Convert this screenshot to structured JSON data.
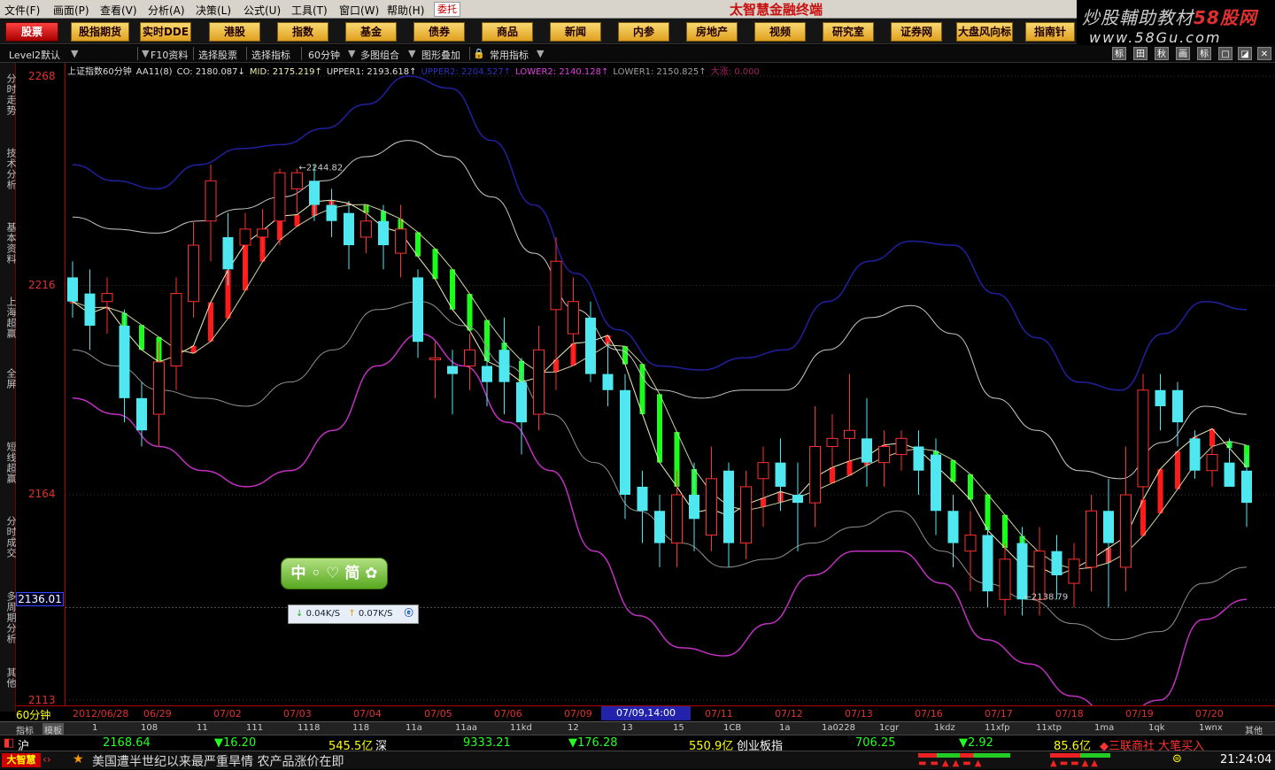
{
  "menu": [
    "文件(F)",
    "画面(P)",
    "查看(V)",
    "分析(A)",
    "决策(L)",
    "公式(U)",
    "工具(T)",
    "窗口(W)",
    "帮助(H)"
  ],
  "trust": "委托",
  "app_title": "太智慧金融终端",
  "brand": {
    "line1a": "炒股輔助教材",
    "line1b": "58股网",
    "line2": "www.58Gu.com"
  },
  "toolbar": [
    "股票",
    "股指期货",
    "实时DDE",
    "港股",
    "指数",
    "基金",
    "债券",
    "商品",
    "新闻",
    "内参",
    "房地产",
    "视频",
    "研究室",
    "证券网",
    "大盘风向标",
    "指南针"
  ],
  "subbar": [
    "Level2默认",
    "F10资料",
    "选择股票",
    "选择指标",
    "60分钟",
    "多图组合",
    "图形叠加",
    "常用指标"
  ],
  "right_icons": [
    "标",
    "田",
    "秋",
    "画",
    "标",
    "□",
    "◪",
    "✕"
  ],
  "side_nav": [
    "分时走势",
    "技术分析",
    "基本资料",
    "上海超赢",
    "全屏",
    "短线超赢",
    "分时成交",
    "多周期分析",
    "其他"
  ],
  "y_axis": {
    "labels": [
      "2268",
      "2216",
      "2164",
      "2113"
    ],
    "current": "2136.01"
  },
  "legend": [
    {
      "text": "上证指数60分钟",
      "color": "#e0e0e0"
    },
    {
      "text": "AA11(8)",
      "color": "#e0e0e0"
    },
    {
      "text": "CO: 2180.087↓",
      "color": "#e0e0e0"
    },
    {
      "text": "MID: 2175.219↑",
      "color": "#f0f0b0"
    },
    {
      "text": "UPPER1: 2193.618↑",
      "color": "#e0e0e0"
    },
    {
      "text": "UPPER2: 2204.527↑",
      "color": "#3030c0"
    },
    {
      "text": "LOWER2: 2140.128↑",
      "color": "#e040e0"
    },
    {
      "text": "LOWER1: 2150.825↑",
      "color": "#a0a0a0"
    },
    {
      "text": "大涨: 0.000",
      "color": "#a02060"
    }
  ],
  "annotations": {
    "high": "2244.82",
    "low": "2138.79"
  },
  "widgets": {
    "ime": "中 ◦ ♡ 简 ✿",
    "speed_down": "0.04K/S",
    "speed_up": "0.07K/S"
  },
  "x_axis": {
    "period": "60分钟",
    "labels": [
      "2012/06/28",
      "06/29",
      "07/02",
      "07/03",
      "07/04",
      "07/05",
      "07/06",
      "07/09",
      "07/11",
      "07/12",
      "07/13",
      "07/16",
      "07/17",
      "07/18",
      "07/19",
      "07/20"
    ],
    "current": "07/09,14:00"
  },
  "tabs": [
    "指标",
    "模板",
    "1",
    "108",
    "11",
    "111",
    "1118",
    "118",
    "11a",
    "11aa",
    "11kd",
    "12",
    "13",
    "15",
    "1CB",
    "1a",
    "1a0228",
    "1cgr",
    "1kdz",
    "11xfp",
    "11xtp",
    "1ma",
    "1qk",
    "1wnx",
    "其他"
  ],
  "quote": {
    "sh_label": "沪",
    "sh_index": "2168.64",
    "sh_change": "▼16.20",
    "sh_volume": "545.5亿",
    "sz_label": "深",
    "sz_index": "9333.21",
    "sz_change": "▼176.28",
    "sz_volume": "550.9亿",
    "cyb_label": "创业板指",
    "cyb_index": "706.25",
    "cyb_change": "▼2.92",
    "cyb_volume": "85.6亿",
    "broker_text": "◆三联商社 大笔买入"
  },
  "status": {
    "logo": "大智慧",
    "news": "美国遭半世纪以来最严重旱情 农产品涨价在即",
    "clock": "21:24:04"
  },
  "chart_data": {
    "type": "candlestick",
    "title": "上证指数60分钟",
    "ylim": [
      2113,
      2268
    ],
    "candles": [
      [
        2218,
        2212,
        2222,
        2208
      ],
      [
        2214,
        2206,
        2220,
        2200
      ],
      [
        2212,
        2214,
        2218,
        2204
      ],
      [
        2206,
        2188,
        2210,
        2182
      ],
      [
        2188,
        2180,
        2192,
        2176
      ],
      [
        2184,
        2197,
        2202,
        2176
      ],
      [
        2196,
        2214,
        2218,
        2190
      ],
      [
        2212,
        2226,
        2232,
        2208
      ],
      [
        2232,
        2242,
        2246,
        2222
      ],
      [
        2228,
        2220,
        2234,
        2216
      ],
      [
        2226,
        2230,
        2234,
        2218
      ],
      [
        2228,
        2230,
        2235,
        2224
      ],
      [
        2232,
        2244,
        2245,
        2226
      ],
      [
        2240,
        2244,
        2245,
        2234
      ],
      [
        2242,
        2236,
        2246,
        2232
      ],
      [
        2236,
        2232,
        2240,
        2228
      ],
      [
        2234,
        2226,
        2237,
        2220
      ],
      [
        2228,
        2232,
        2236,
        2224
      ],
      [
        2232,
        2226,
        2236,
        2220
      ],
      [
        2224,
        2230,
        2236,
        2218
      ],
      [
        2218,
        2202,
        2220,
        2198
      ],
      [
        2198,
        2198,
        2202,
        2188
      ],
      [
        2196,
        2194,
        2200,
        2184
      ],
      [
        2196,
        2200,
        2204,
        2190
      ],
      [
        2196,
        2192,
        2200,
        2186
      ],
      [
        2200,
        2192,
        2208,
        2184
      ],
      [
        2192,
        2182,
        2198,
        2174
      ],
      [
        2184,
        2200,
        2206,
        2180
      ],
      [
        2210,
        2222,
        2228,
        2190
      ],
      [
        2204,
        2212,
        2218,
        2196
      ],
      [
        2208,
        2194,
        2212,
        2192
      ],
      [
        2194,
        2190,
        2202,
        2186
      ],
      [
        2190,
        2164,
        2194,
        2158
      ],
      [
        2166,
        2160,
        2170,
        2152
      ],
      [
        2160,
        2152,
        2164,
        2146
      ],
      [
        2152,
        2164,
        2170,
        2146
      ],
      [
        2164,
        2158,
        2172,
        2150
      ],
      [
        2154,
        2168,
        2176,
        2150
      ],
      [
        2170,
        2152,
        2172,
        2146
      ],
      [
        2152,
        2166,
        2170,
        2148
      ],
      [
        2168,
        2172,
        2176,
        2156
      ],
      [
        2172,
        2166,
        2178,
        2160
      ],
      [
        2164,
        2162,
        2172,
        2150
      ],
      [
        2162,
        2176,
        2186,
        2156
      ],
      [
        2176,
        2178,
        2184,
        2170
      ],
      [
        2178,
        2180,
        2194,
        2172
      ],
      [
        2178,
        2172,
        2188,
        2166
      ],
      [
        2172,
        2176,
        2180,
        2166
      ],
      [
        2174,
        2178,
        2180,
        2170
      ],
      [
        2176,
        2170,
        2180,
        2164
      ],
      [
        2174,
        2160,
        2178,
        2154
      ],
      [
        2160,
        2152,
        2164,
        2146
      ],
      [
        2150,
        2154,
        2160,
        2140
      ],
      [
        2154,
        2140,
        2156,
        2136
      ],
      [
        2138,
        2148,
        2152,
        2134
      ],
      [
        2152,
        2138,
        2156,
        2134
      ],
      [
        2138,
        2150,
        2156,
        2134
      ],
      [
        2150,
        2144,
        2154,
        2138
      ],
      [
        2142,
        2148,
        2152,
        2136
      ],
      [
        2146,
        2160,
        2164,
        2140
      ],
      [
        2160,
        2152,
        2168,
        2136
      ],
      [
        2146,
        2164,
        2176,
        2140
      ],
      [
        2166,
        2190,
        2194,
        2162
      ],
      [
        2190,
        2186,
        2194,
        2180
      ],
      [
        2190,
        2182,
        2192,
        2176
      ],
      [
        2178,
        2170,
        2180,
        2168
      ],
      [
        2170,
        2174,
        2176,
        2166
      ],
      [
        2172,
        2166,
        2178,
        2168
      ],
      [
        2170,
        2162,
        2174,
        2156
      ]
    ],
    "aa11_bands": {
      "bull_color": "#ff1a1a",
      "bear_color": "#1aff1a"
    },
    "lines": [
      {
        "name": "UPPER2",
        "color": "#2020a0"
      },
      {
        "name": "UPPER1",
        "color": "#c8c8c8"
      },
      {
        "name": "MID",
        "color": "#f0f0c0"
      },
      {
        "name": "LOWER1",
        "color": "#909090"
      },
      {
        "name": "LOWER2",
        "color": "#c030c0"
      }
    ],
    "upper2": [
      2246,
      2242,
      2240,
      2246,
      2250,
      2251,
      2255,
      2261,
      2268,
      2265,
      2252,
      2236,
      2219,
      2205,
      2196,
      2195,
      2198,
      2200,
      2212,
      2222,
      2227,
      2226,
      2214,
      2203,
      2192,
      2190,
      2204,
      2212,
      2210
    ],
    "upper1": [
      2233,
      2230,
      2229,
      2232,
      2235,
      2238,
      2242,
      2248,
      2252,
      2248,
      2238,
      2224,
      2210,
      2200,
      2190,
      2188,
      2190,
      2190,
      2200,
      2208,
      2211,
      2204,
      2188,
      2180,
      2170,
      2168,
      2177,
      2186,
      2184
    ],
    "mid": [
      2218,
      2212,
      2206,
      2214,
      2222,
      2230,
      2228,
      2210,
      2196,
      2192,
      2188,
      2180,
      2170,
      2162,
      2160,
      2164,
      2170,
      2178,
      2176,
      2168,
      2162,
      2158,
      2156,
      2158,
      2168,
      2178,
      2176
    ],
    "lower1": [
      2200,
      2196,
      2190,
      2188,
      2186,
      2192,
      2200,
      2210,
      2212,
      2206,
      2196,
      2184,
      2172,
      2160,
      2152,
      2146,
      2148,
      2152,
      2156,
      2160,
      2150,
      2142,
      2138,
      2132,
      2128,
      2130,
      2142,
      2146
    ],
    "lower2": [
      2188,
      2184,
      2176,
      2170,
      2166,
      2170,
      2180,
      2196,
      2204,
      2196,
      2182,
      2170,
      2150,
      2134,
      2126,
      2124,
      2132,
      2144,
      2150,
      2150,
      2142,
      2128,
      2122,
      2114,
      2108,
      2113,
      2133,
      2138
    ]
  }
}
